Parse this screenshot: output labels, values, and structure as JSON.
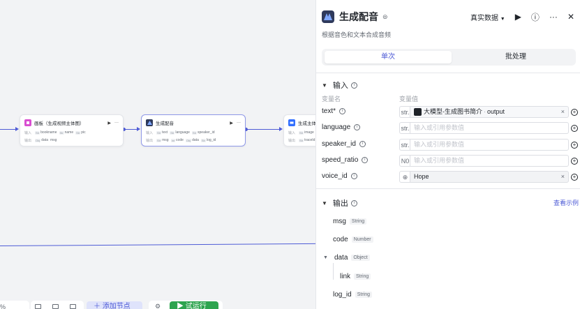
{
  "canvas": {
    "nodes": [
      {
        "title": "画板（生成视频主体图）",
        "icon_color": "#d94fd1",
        "input_label": "输入",
        "inputs": [
          {
            "type": "Str",
            "name": "bookname"
          },
          {
            "type": "Str",
            "name": "name"
          },
          {
            "type": "Str",
            "name": "pic"
          }
        ],
        "output_label": "输出",
        "outputs": [
          {
            "type": "Obj",
            "name": "data"
          },
          {
            "type": "",
            "name": "msg"
          }
        ]
      },
      {
        "title": "生成配音",
        "icon_color": "#2f3a5c",
        "input_label": "输入",
        "inputs": [
          {
            "type": "Str",
            "name": "text"
          },
          {
            "type": "Str",
            "name": "language"
          },
          {
            "type": "Str",
            "name": "speaker_id"
          }
        ],
        "output_label": "输出",
        "outputs": [
          {
            "type": "Str",
            "name": "msg"
          },
          {
            "type": "Int",
            "name": "code"
          },
          {
            "type": "Obj",
            "name": "data"
          },
          {
            "type": "Str",
            "name": "log_id"
          }
        ]
      },
      {
        "title": "生成主体",
        "icon_color": "#3370ff",
        "input_label": "输入",
        "inputs": [
          {
            "type": "Str",
            "name": "image"
          }
        ],
        "output_label": "输出",
        "outputs": [
          {
            "type": "Str",
            "name": "traceId"
          }
        ]
      }
    ],
    "toolbar": {
      "zoom": "%",
      "add_node": "添加节点",
      "test_run": "试运行"
    }
  },
  "panel": {
    "title": "生成配音",
    "description": "根据音色和文本合成音频",
    "data_mode": "真实数据",
    "tabs": {
      "single": "单次",
      "batch": "批处理"
    },
    "inputs_section": {
      "title": "输入",
      "col_name": "变量名",
      "col_value": "变量值",
      "rows": [
        {
          "name": "text*",
          "type": "str.",
          "kind": "ref",
          "ref_source": "大模型-生成图书简介",
          "ref_sep": "·",
          "ref_field": "output",
          "clear": "×"
        },
        {
          "name": "language",
          "type": "str.",
          "kind": "empty",
          "placeholder": "输入或引用参数值"
        },
        {
          "name": "speaker_id",
          "type": "str.",
          "kind": "empty",
          "placeholder": "输入或引用参数值"
        },
        {
          "name": "speed_ratio",
          "type": "N0",
          "kind": "empty",
          "placeholder": "输入或引用参数值"
        },
        {
          "name": "voice_id",
          "type": "⊕",
          "kind": "filled",
          "value": "Hope",
          "clear": "×"
        }
      ]
    },
    "outputs_section": {
      "title": "输出",
      "view_example": "查看示例",
      "rows": [
        {
          "name": "msg",
          "type": "String"
        },
        {
          "name": "code",
          "type": "Number"
        },
        {
          "name": "data",
          "type": "Object"
        },
        {
          "name": "link",
          "type": "String"
        },
        {
          "name": "log_id",
          "type": "String"
        }
      ]
    }
  }
}
